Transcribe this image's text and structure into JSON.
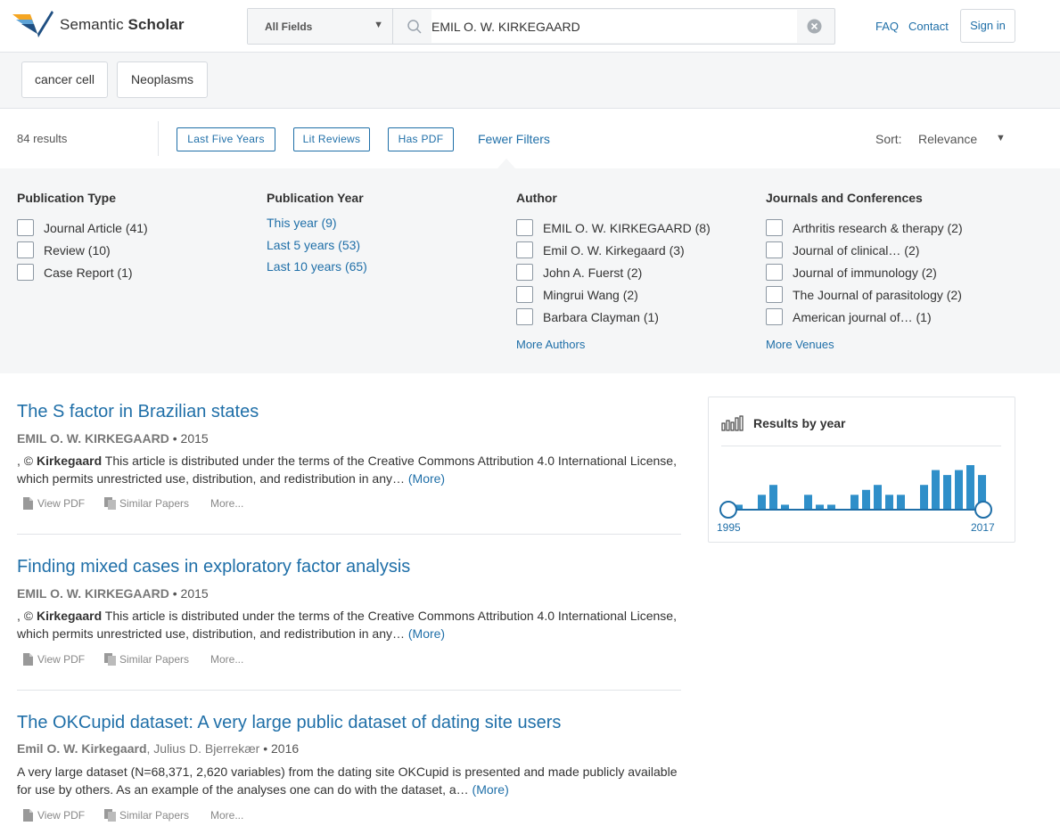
{
  "brand": {
    "name_light": "Semantic ",
    "name_bold": "Scholar"
  },
  "search": {
    "field_select": "All Fields",
    "query": "EMIL O. W. KIRKEGAARD"
  },
  "header_links": {
    "faq": "FAQ",
    "contact": "Contact",
    "signin": "Sign in"
  },
  "chips": [
    "cancer cell",
    "Neoplasms"
  ],
  "filterbar": {
    "results_count": "84 results",
    "buttons": [
      "Last Five Years",
      "Lit Reviews",
      "Has PDF"
    ],
    "fewer_filters": "Fewer Filters",
    "sort_label": "Sort:",
    "sort_value": "Relevance"
  },
  "facets": {
    "publication_type": {
      "title": "Publication Type",
      "items": [
        "Journal Article (41)",
        "Review (10)",
        "Case Report (1)"
      ]
    },
    "publication_year": {
      "title": "Publication Year",
      "items": [
        "This year (9)",
        "Last 5 years (53)",
        "Last 10 years (65)"
      ]
    },
    "author": {
      "title": "Author",
      "items": [
        "EMIL O. W. KIRKEGAARD (8)",
        "Emil O. W. Kirkegaard (3)",
        "John A. Fuerst (2)",
        "Mingrui Wang (2)",
        "Barbara Clayman (1)"
      ],
      "more": "More Authors"
    },
    "journals": {
      "title": "Journals and Conferences",
      "items": [
        "Arthritis research & therapy (2)",
        "Journal of clinical… (2)",
        "Journal of immunology (2)",
        "The Journal of parasitology (2)",
        "American journal of… (1)"
      ],
      "more": "More Venues"
    }
  },
  "results": [
    {
      "title": "The S factor in Brazilian states",
      "author": "EMIL O. W. KIRKEGAARD",
      "coauthors": "",
      "year": " • 2015",
      "abstract_prefix": ", © ",
      "abstract_bold": "Kirkegaard",
      "abstract_rest": " This article is distributed under the terms of the Creative Commons Attribution 4.0 International License, which permits unrestricted use, distribution, and redistribution in any… ",
      "more": "(More)",
      "actions": [
        "View PDF",
        "Similar Papers",
        "More..."
      ]
    },
    {
      "title": "Finding mixed cases in exploratory factor analysis",
      "author": "EMIL O. W. KIRKEGAARD",
      "coauthors": "",
      "year": " • 2015",
      "abstract_prefix": ", © ",
      "abstract_bold": "Kirkegaard",
      "abstract_rest": " This article is distributed under the terms of the Creative Commons Attribution 4.0 International License, which permits unrestricted use, distribution, and redistribution in any… ",
      "more": "(More)",
      "actions": [
        "View PDF",
        "Similar Papers",
        "More..."
      ]
    },
    {
      "title": "The OKCupid dataset: A very large public dataset of dating site users",
      "author": "Emil O. W. Kirkegaard",
      "coauthors": ", Julius D. Bjerrekær",
      "year": " • 2016",
      "abstract_prefix": "",
      "abstract_bold": "",
      "abstract_rest": "A very large dataset (N=68,371, 2,620 variables) from the dating site OKCupid is presented and made publicly available for use by others. As an example of the analyses one can do with the dataset, a… ",
      "more": "(More)",
      "actions": [
        "View PDF",
        "Similar Papers",
        "More..."
      ]
    }
  ],
  "results_by_year": {
    "title": "Results by year",
    "start_label": "1995",
    "end_label": "2017",
    "colors": {
      "bar": "#2f8fc9",
      "accent": "#1f6fa8"
    }
  },
  "chart_data": {
    "type": "bar",
    "title": "Results by year",
    "categories": [
      "1995",
      "1996",
      "1997",
      "1998",
      "1999",
      "2000",
      "2001",
      "2002",
      "2003",
      "2004",
      "2005",
      "2006",
      "2007",
      "2008",
      "2009",
      "2010",
      "2011",
      "2012",
      "2013",
      "2014",
      "2015",
      "2016",
      "2017"
    ],
    "values": [
      1,
      0,
      3,
      5,
      1,
      0,
      3,
      1,
      1,
      0,
      3,
      4,
      5,
      3,
      3,
      0,
      5,
      8,
      7,
      8,
      9,
      7,
      0
    ],
    "xlabel": "",
    "ylabel": "",
    "range": [
      "1995",
      "2017"
    ]
  }
}
